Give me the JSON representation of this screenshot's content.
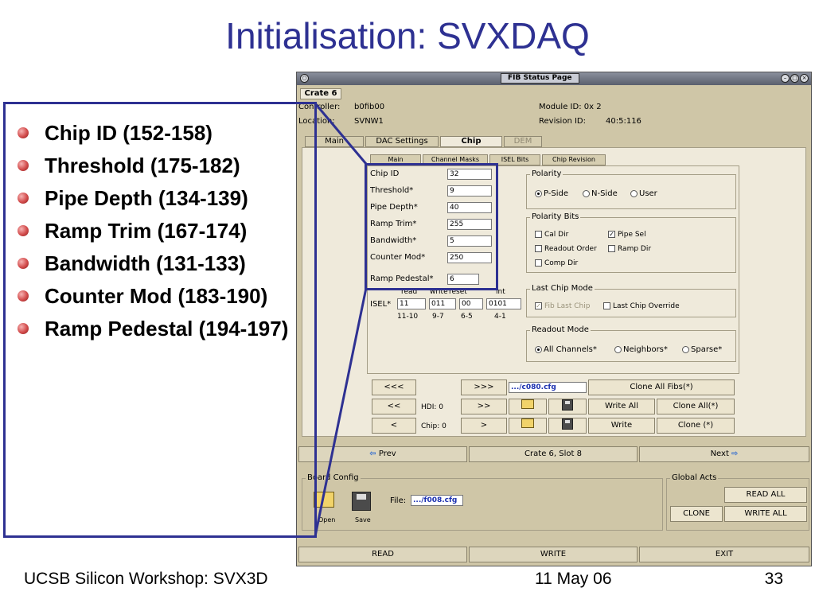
{
  "slide": {
    "title": "Initialisation: SVXDAQ",
    "bullets": [
      "Chip ID (152-158)",
      "Threshold (175-182)",
      "Pipe Depth (134-139)",
      "Ramp Trim (167-174)",
      "Bandwidth (131-133)",
      "Counter Mod (183-190)",
      "Ramp Pedestal (194-197)"
    ],
    "footer_left": "UCSB Silicon Workshop: SVX3D",
    "footer_center": "11 May 06",
    "footer_right": "33"
  },
  "window": {
    "title": "FIB Status Page",
    "crate_tab": "Crate 6",
    "controller_label": "Controller:",
    "controller_value": "b0fib00",
    "location_label": "Location:",
    "location_value": "SVNW1",
    "module_id": "Module ID: 0x 2",
    "revision_label": "Revision ID:",
    "revision_value": "40:5:116",
    "tabs": [
      "Main",
      "DAC Settings",
      "Chip",
      "DEM"
    ],
    "subtabs": [
      "Main",
      "Channel Masks",
      "ISEL Bits",
      "Chip Revision"
    ],
    "chip_fields": [
      {
        "label": "Chip ID",
        "value": "32"
      },
      {
        "label": "Threshold*",
        "value": "9"
      },
      {
        "label": "Pipe Depth*",
        "value": "40"
      },
      {
        "label": "Ramp Trim*",
        "value": "255"
      },
      {
        "label": "Bandwidth*",
        "value": "5"
      },
      {
        "label": "Counter Mod*",
        "value": "250"
      },
      {
        "label": "Ramp Pedestal*",
        "value": "6"
      }
    ],
    "isel": {
      "headers": [
        "read",
        "write",
        "reset",
        "int"
      ],
      "label": "ISEL*",
      "values": [
        "11",
        "011",
        "00",
        "0101"
      ],
      "bits": [
        "11-10",
        "9-7",
        "6-5",
        "4-1"
      ]
    },
    "polarity": {
      "title": "Polarity",
      "options": [
        "P-Side",
        "N-Side",
        "User"
      ],
      "selected": "P-Side"
    },
    "polarity_bits": {
      "title": "Polarity Bits",
      "items": [
        {
          "label": "Cal Dir",
          "checked": false
        },
        {
          "label": "Pipe Sel",
          "checked": true
        },
        {
          "label": "Readout Order",
          "checked": false
        },
        {
          "label": "Ramp Dir",
          "checked": false
        },
        {
          "label": "Comp Dir",
          "checked": false
        }
      ]
    },
    "last_chip": {
      "title": "Last Chip Mode",
      "fib_last_chip": "Fib Last Chip",
      "override": "Last Chip Override"
    },
    "readout_mode": {
      "title": "Readout Mode",
      "options": [
        "All Channels*",
        "Neighbors*",
        "Sparse*"
      ],
      "selected": "All Channels*"
    },
    "nav": {
      "fast_back": "<<<",
      "fast_fwd": ">>>",
      "back": "<<",
      "fwd": ">>",
      "step_back": "<",
      "step_fwd": ">",
      "hdi": "HDI: 0",
      "chip": "Chip: 0",
      "cfg_file": ".../c080.cfg",
      "clone_all_fibs": "Clone All Fibs(*)",
      "write_all": "Write All",
      "clone_all": "Clone All(*)",
      "write": "Write",
      "clone": "Clone (*)"
    },
    "slot_bar": {
      "prev": "Prev",
      "center": "Crate 6, Slot 8",
      "next": "Next"
    },
    "board_config": {
      "title": "Board Config",
      "open": "Open",
      "save": "Save",
      "file_label": "File:",
      "file_value": ".../f008.cfg"
    },
    "global_acts": {
      "title": "Global Acts",
      "read_all": "READ ALL",
      "clone": "CLONE",
      "write_all": "WRITE ALL"
    },
    "bottom": {
      "read": "READ",
      "write": "WRITE",
      "exit": "EXIT"
    }
  },
  "colors": {
    "title_blue": "#2e3192",
    "bullet_red": "#d24b4b",
    "window_bg": "#cfc6a7",
    "panel_bg": "#efeadb"
  }
}
